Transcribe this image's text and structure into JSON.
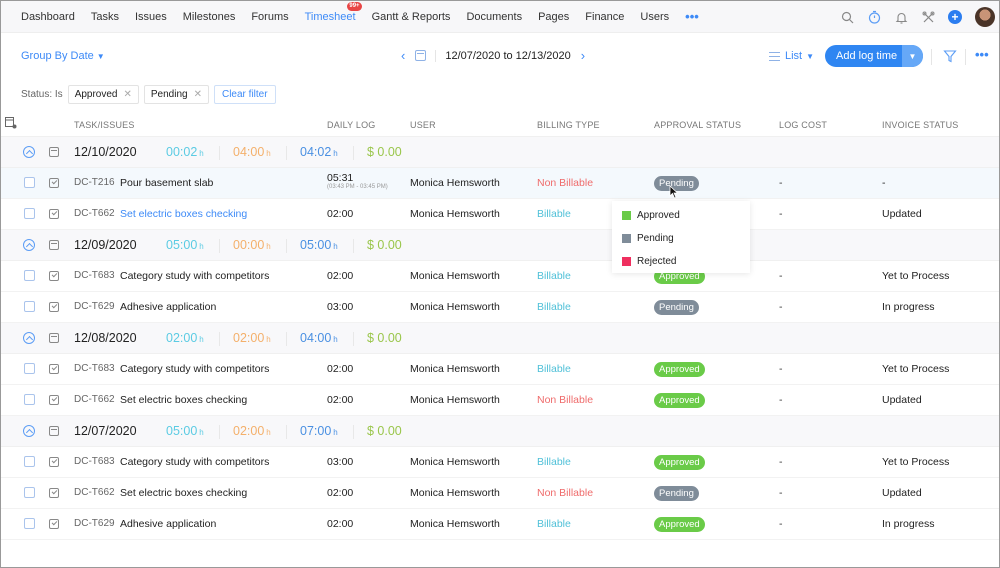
{
  "nav": {
    "items": [
      {
        "label": "Dashboard",
        "active": false
      },
      {
        "label": "Tasks",
        "active": false
      },
      {
        "label": "Issues",
        "active": false
      },
      {
        "label": "Milestones",
        "active": false
      },
      {
        "label": "Forums",
        "active": false
      },
      {
        "label": "Timesheet",
        "active": true,
        "badge": "99+"
      },
      {
        "label": "Gantt & Reports",
        "active": false
      },
      {
        "label": "Documents",
        "active": false
      },
      {
        "label": "Pages",
        "active": false
      },
      {
        "label": "Finance",
        "active": false
      },
      {
        "label": "Users",
        "active": false
      }
    ],
    "more": "•••",
    "icons": [
      "search-icon",
      "timer-icon",
      "bell-icon",
      "tools-icon",
      "plus-icon",
      "avatar"
    ]
  },
  "toolbar": {
    "group_by": "Group By Date",
    "date_range": "12/07/2020 to 12/13/2020",
    "view": "List",
    "add_log_time": "Add log time",
    "more": "•••"
  },
  "filters": {
    "label": "Status: Is",
    "chips": [
      "Approved",
      "Pending"
    ],
    "clear": "Clear filter"
  },
  "table": {
    "headers": {
      "task": "TASK/ISSUES",
      "daily_log": "DAILY LOG",
      "user": "USER",
      "billing": "BILLING TYPE",
      "approval": "APPROVAL STATUS",
      "log_cost": "LOG COST",
      "invoice": "INVOICE STATUS"
    },
    "unit": "h",
    "groups": [
      {
        "date": "12/10/2020",
        "billable": "00:02",
        "non_billable": "04:00",
        "total": "04:02",
        "cost": "$ 0.00",
        "rows": [
          {
            "id": "DC-T216",
            "name": "Pour basement slab",
            "link": false,
            "daily": "05:31",
            "range": "(03:43 PM - 03:45 PM)",
            "user": "Monica Hemsworth",
            "billing": "Non Billable",
            "status": "Pending",
            "cost": "-",
            "invoice": "-"
          },
          {
            "id": "DC-T662",
            "name": "Set electric  boxes checking",
            "link": true,
            "daily": "02:00",
            "user": "Monica Hemsworth",
            "billing": "Billable",
            "status": "",
            "cost": "-",
            "invoice": "Updated"
          }
        ]
      },
      {
        "date": "12/09/2020",
        "billable": "05:00",
        "non_billable": "00:00",
        "total": "05:00",
        "cost": "$ 0.00",
        "rows": [
          {
            "id": "DC-T683",
            "name": "Category study with competitors",
            "daily": "02:00",
            "user": "Monica Hemsworth",
            "billing": "Billable",
            "status": "Approved",
            "cost": "-",
            "invoice": "Yet to Process"
          },
          {
            "id": "DC-T629",
            "name": "Adhesive application",
            "daily": "03:00",
            "user": "Monica Hemsworth",
            "billing": "Billable",
            "status": "Pending",
            "cost": "-",
            "invoice": "In progress"
          }
        ]
      },
      {
        "date": "12/08/2020",
        "billable": "02:00",
        "non_billable": "02:00",
        "total": "04:00",
        "cost": "$ 0.00",
        "rows": [
          {
            "id": "DC-T683",
            "name": "Category study with competitors",
            "daily": "02:00",
            "user": "Monica Hemsworth",
            "billing": "Billable",
            "status": "Approved",
            "cost": "-",
            "invoice": "Yet to Process"
          },
          {
            "id": "DC-T662",
            "name": "Set electric boxes checking",
            "daily": "02:00",
            "user": "Monica Hemsworth",
            "billing": "Non Billable",
            "status": "Approved",
            "cost": "-",
            "invoice": "Updated"
          }
        ]
      },
      {
        "date": "12/07/2020",
        "billable": "05:00",
        "non_billable": "02:00",
        "total": "07:00",
        "cost": "$ 0.00",
        "rows": [
          {
            "id": "DC-T683",
            "name": "Category study with competitors",
            "daily": "03:00",
            "user": "Monica Hemsworth",
            "billing": "Billable",
            "status": "Approved",
            "cost": "-",
            "invoice": "Yet to Process"
          },
          {
            "id": "DC-T662",
            "name": "Set electric boxes checking",
            "daily": "02:00",
            "user": "Monica Hemsworth",
            "billing": "Non Billable",
            "status": "Pending",
            "cost": "-",
            "invoice": "Updated"
          },
          {
            "id": "DC-T629",
            "name": "Adhesive application",
            "daily": "02:00",
            "user": "Monica Hemsworth",
            "billing": "Billable",
            "status": "Approved",
            "cost": "-",
            "invoice": "In progress"
          }
        ]
      }
    ]
  },
  "status_dropdown": {
    "options": [
      {
        "label": "Approved",
        "color": "#6acb48"
      },
      {
        "label": "Pending",
        "color": "#7f8c99"
      },
      {
        "label": "Rejected",
        "color": "#ef2f5f"
      }
    ]
  },
  "colors": {
    "accent": "#2f86f2",
    "billable": "#4fc0d8",
    "non_billable": "#ef6b6b",
    "approved": "#6acb48",
    "pending": "#7f8c99"
  }
}
